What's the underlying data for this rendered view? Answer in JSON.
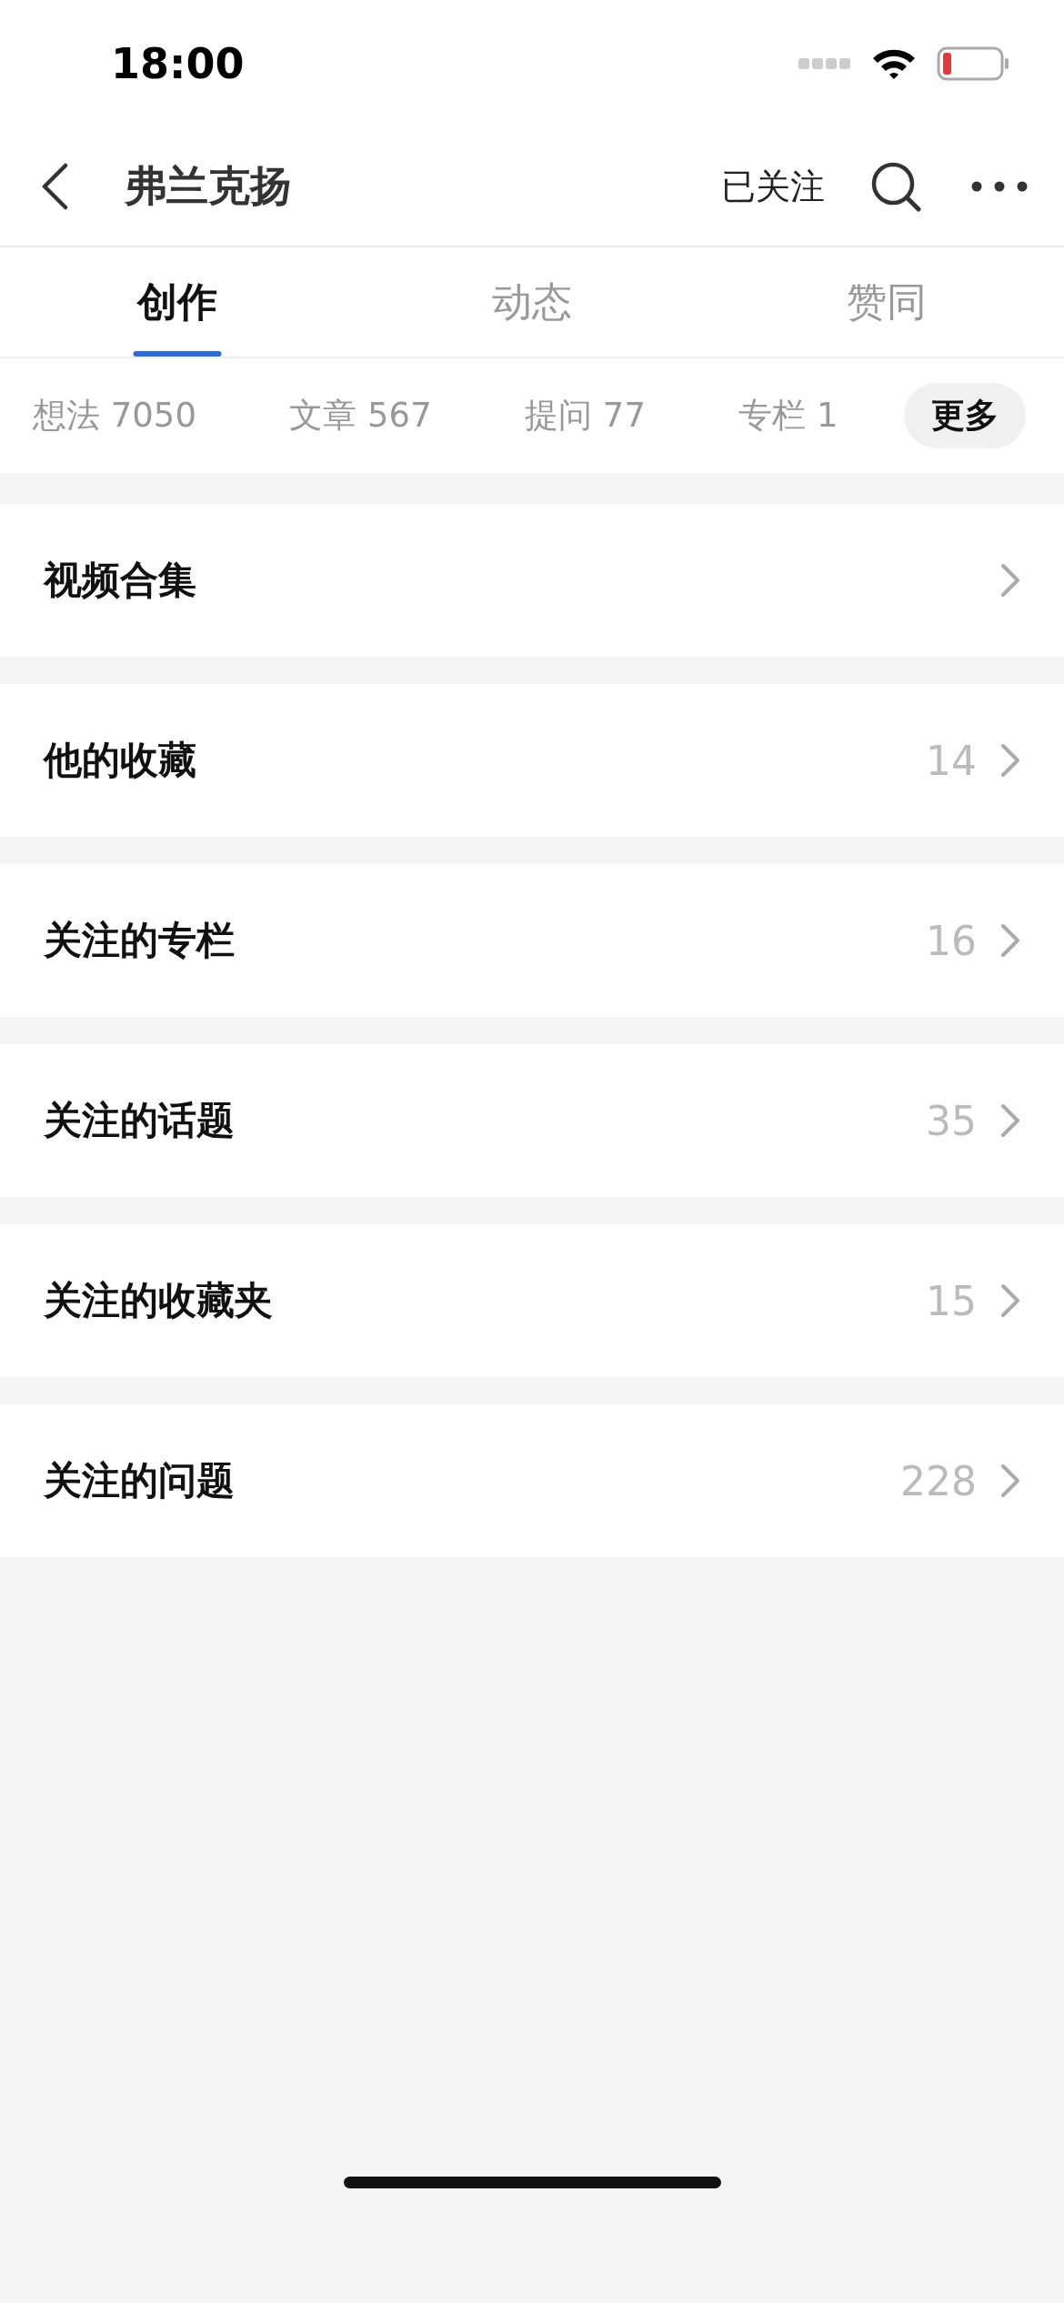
{
  "status_bar": {
    "time": "18:00"
  },
  "nav": {
    "title": "弗兰克扬",
    "follow": "已关注"
  },
  "tabs": [
    {
      "label": "创作",
      "selected": true
    },
    {
      "label": "动态",
      "selected": false
    },
    {
      "label": "赞同",
      "selected": false
    }
  ],
  "subtabs": [
    {
      "label": "想法 7050",
      "selected": false
    },
    {
      "label": "文章 567",
      "selected": false
    },
    {
      "label": "提问 77",
      "selected": false
    },
    {
      "label": "专栏 1",
      "selected": false
    },
    {
      "label": "更多",
      "selected": true
    }
  ],
  "rows": [
    {
      "label": "视频合集"
    },
    {
      "label": "他的收藏",
      "count": "14"
    },
    {
      "label": "关注的专栏",
      "count": "16"
    },
    {
      "label": "关注的话题",
      "count": "35"
    },
    {
      "label": "关注的收藏夹",
      "count": "15"
    },
    {
      "label": "关注的问题",
      "count": "228"
    }
  ]
}
